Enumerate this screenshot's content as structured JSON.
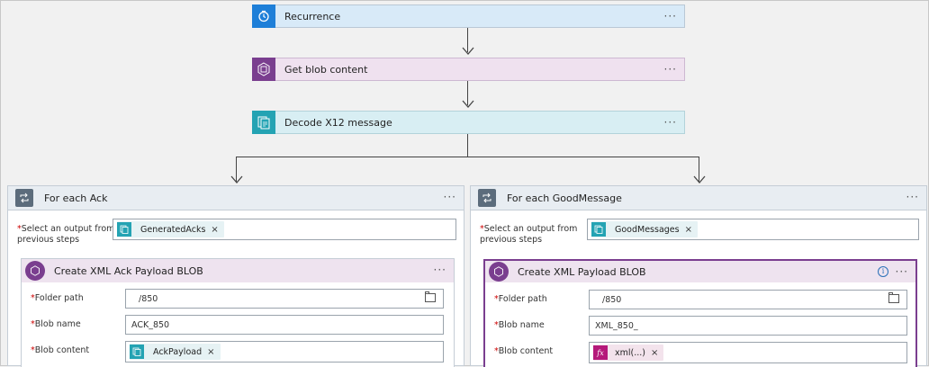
{
  "steps": {
    "recurrence": {
      "label": "Recurrence",
      "color": "#d8eaf8",
      "icon_color": "#1e7fd8",
      "icon": "clock-icon"
    },
    "get_blob": {
      "label": "Get blob content",
      "color": "#efe1ef",
      "icon_color": "#7a3e8f",
      "icon": "blob-icon"
    },
    "decode": {
      "label": "Decode X12 message",
      "color": "#d8eef3",
      "icon_color": "#24a3b3",
      "icon": "document-icon"
    }
  },
  "more_label": "···",
  "left_scope": {
    "title": "For each Ack",
    "select_label_line1": "Select an output from",
    "select_label_line2": "previous steps",
    "token": "GeneratedAcks",
    "token_remove": "×",
    "action": {
      "title": "Create XML Ack Payload BLOB",
      "folder_label": "Folder path",
      "folder_value": "/850",
      "blob_name_label": "Blob name",
      "blob_name_value": "ACK_850",
      "blob_content_label": "Blob content",
      "blob_content_token": "AckPayload",
      "token_remove": "×"
    }
  },
  "right_scope": {
    "title": "For each GoodMessage",
    "select_label_line1": "Select an output from",
    "select_label_line2": "previous steps",
    "token": "GoodMessages",
    "token_remove": "×",
    "action": {
      "title": "Create XML Payload BLOB",
      "folder_label": "Folder path",
      "folder_value": "/850",
      "blob_name_label": "Blob name",
      "blob_name_value": "XML_850_",
      "blob_content_label": "Blob content",
      "blob_content_token": "xml(...)",
      "token_remove": "×",
      "fx_label": "fx"
    }
  },
  "required_mark": "*",
  "accent_purple": "#7a3e8f",
  "accent_teal": "#24a3b3"
}
